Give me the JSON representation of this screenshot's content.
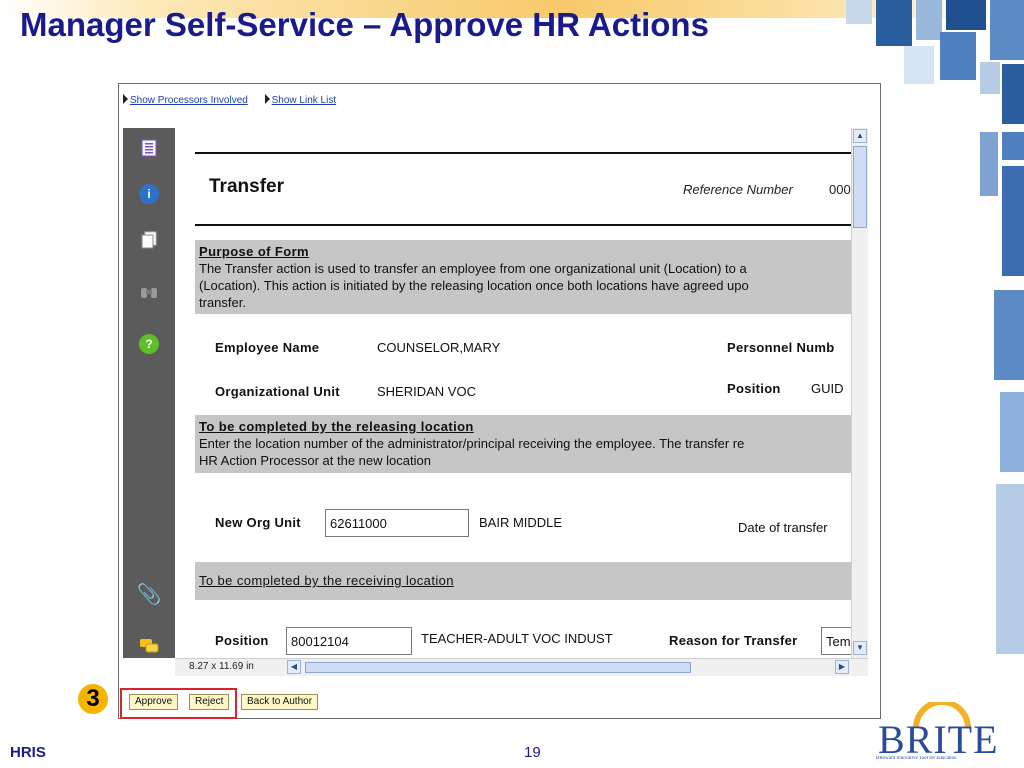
{
  "slide": {
    "title": "Manager Self-Service – Approve HR Actions",
    "step_number": "3",
    "footer_left": "HRIS",
    "page_number": "19",
    "logo_text": "BRITE",
    "logo_tagline": "BRoward Innovative Tool for Education"
  },
  "linkbar": {
    "processors_label": "Show Processors Involved",
    "links_label": "Show Link List"
  },
  "sidebar_icons": [
    "page-thumbnail-icon",
    "info-icon",
    "pages-icon",
    "binoculars-icon",
    "help-icon",
    "paperclip-icon",
    "comments-icon"
  ],
  "form": {
    "title": "Transfer",
    "reference_label": "Reference Number",
    "reference_value": "000",
    "purpose": {
      "heading": "Purpose of Form",
      "text": "The Transfer action is used to transfer an employee from one organizational unit (Location) to a\n(Location). This action is initiated by the releasing location once both locations have agreed upo\ntransfer."
    },
    "employee_name_label": "Employee Name",
    "employee_name_value": "COUNSELOR,MARY",
    "personnel_number_label": "Personnel Numb",
    "org_unit_label": "Organizational Unit",
    "org_unit_value": "SHERIDAN VOC",
    "position_label": "Position",
    "position_value": "GUID",
    "releasing": {
      "heading": "To be completed by the releasing location",
      "text": "Enter the location number of the administrator/principal receiving the employee. The transfer re\nHR Action Processor at the new location"
    },
    "new_org_unit_label": "New Org Unit",
    "new_org_unit_value": "62611000",
    "new_org_unit_name": "BAIR MIDDLE",
    "date_of_transfer_label": "Date of transfer",
    "receiving": {
      "heading": "To be completed by the receiving location"
    },
    "position2_label": "Position",
    "position2_value": "80012104",
    "position2_name": "TEACHER-ADULT VOC INDUST",
    "reason_label": "Reason for Transfer",
    "reason_value": "Tem"
  },
  "viewer": {
    "page_size": "8.27 x 11.69 in"
  },
  "actions": {
    "approve_label": "Approve",
    "reject_label": "Reject",
    "back_label": "Back to Author"
  },
  "colors": {
    "title_blue": "#1a1a8c",
    "highlight_red": "#e0202a",
    "badge_yellow": "#f5b400",
    "section_gray": "#c6c6c6",
    "button_cream": "#fff7c8"
  }
}
